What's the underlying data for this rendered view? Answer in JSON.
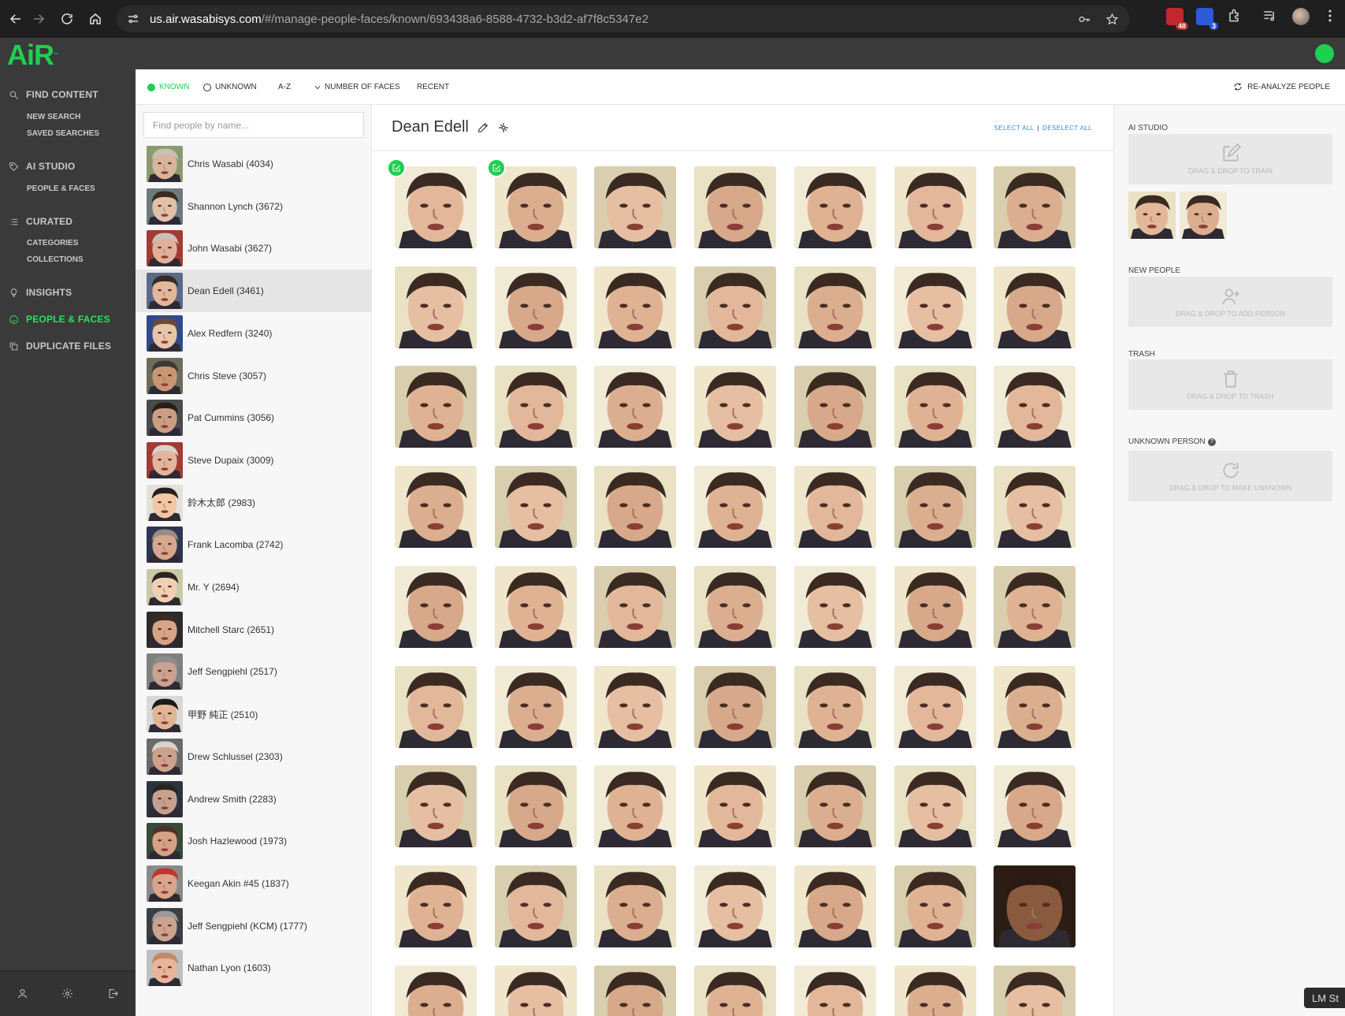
{
  "browser": {
    "url_host": "us.air.wasabisys.com",
    "url_path": "/#/manage-people-faces/known/693438a6-8588-4732-b3d2-af7f8c5347e2",
    "ext_badges": [
      "48",
      "3"
    ]
  },
  "app": {
    "logo": "AiR",
    "logo_mark": "™",
    "status_color": "#1fcf4f",
    "accent": "#1fcf4f"
  },
  "nav": {
    "find_content": "FIND CONTENT",
    "new_search": "NEW SEARCH",
    "saved_searches": "SAVED SEARCHES",
    "ai_studio": "AI STUDIO",
    "people_faces_sub": "PEOPLE & FACES",
    "curated": "CURATED",
    "categories": "CATEGORIES",
    "collections": "COLLECTIONS",
    "insights": "INSIGHTS",
    "people_faces": "PEOPLE & FACES",
    "duplicate_files": "DUPLICATE FILES"
  },
  "filters": {
    "known": "KNOWN",
    "unknown": "UNKNOWN",
    "az": "A-Z",
    "number_of_faces": "NUMBER OF FACES",
    "recent": "RECENT",
    "reanalyze": "RE-ANALYZE PEOPLE"
  },
  "people": {
    "search_placeholder": "Find people by name...",
    "selected": "Dean Edell (3461)",
    "list": [
      {
        "name": "Chris Wasabi (4034)",
        "skin": "#d9b59c",
        "hair": "#c9c0b4",
        "bg": "#8a9a6e"
      },
      {
        "name": "Shannon Lynch (3672)",
        "skin": "#e2c0a8",
        "hair": "#3b2a22",
        "bg": "#6c7a7e"
      },
      {
        "name": "John Wasabi (3627)",
        "skin": "#e0b09a",
        "hair": "#c8c0bb",
        "bg": "#a33b32"
      },
      {
        "name": "Dean Edell (3461)",
        "skin": "#e2b79a",
        "hair": "#3a2a22",
        "bg": "#5b6a8a"
      },
      {
        "name": "Alex Redfern (3240)",
        "skin": "#e8c4a8",
        "hair": "#6a4a36",
        "bg": "#2f4a8a"
      },
      {
        "name": "Chris Steve (3057)",
        "skin": "#c99674",
        "hair": "#3a3a3a",
        "bg": "#6c6c58"
      },
      {
        "name": "Pat Cummins (3056)",
        "skin": "#c99e82",
        "hair": "#2a1e1a",
        "bg": "#4a4a4a"
      },
      {
        "name": "Steve Dupaix (3009)",
        "skin": "#e6b49e",
        "hair": "#d8d2cc",
        "bg": "#a23a36"
      },
      {
        "name": "鈴木太郎 (2983)",
        "skin": "#f1c7a6",
        "hair": "#2a2020",
        "bg": "#e6e1d8"
      },
      {
        "name": "Frank Lacomba (2742)",
        "skin": "#d6a68e",
        "hair": "#9a8c84",
        "bg": "#2d3550"
      },
      {
        "name": "Mr. Y (2694)",
        "skin": "#efd0b4",
        "hair": "#2b2420",
        "bg": "#c9c9a6"
      },
      {
        "name": "Mitchell Starc (2651)",
        "skin": "#d7a486",
        "hair": "#3a2a22",
        "bg": "#2a2a2a"
      },
      {
        "name": "Jeff Sengpiehl (2517)",
        "skin": "#c9a290",
        "hair": "#8d8d8d",
        "bg": "#808080"
      },
      {
        "name": "甲野 純正 (2510)",
        "skin": "#e0b494",
        "hair": "#1e1a18",
        "bg": "#d8d8d8"
      },
      {
        "name": "Drew Schlussel (2303)",
        "skin": "#cca28c",
        "hair": "#d9d3cc",
        "bg": "#6a6a6a"
      },
      {
        "name": "Andrew Smith (2283)",
        "skin": "#c8a090",
        "hair": "#2a2420",
        "bg": "#2c3340"
      },
      {
        "name": "Josh Hazlewood (1973)",
        "skin": "#d6a084",
        "hair": "#4a3428",
        "bg": "#3a4a3a"
      },
      {
        "name": "Keegan Akin #45 (1837)",
        "skin": "#d9a48a",
        "hair": "#c0342a",
        "bg": "#8a8a8a"
      },
      {
        "name": "Jeff Sengpiehl (KCM) (1777)",
        "skin": "#c9a290",
        "hair": "#9a9a9a",
        "bg": "#3a3f44"
      },
      {
        "name": "Nathan Lyon (1603)",
        "skin": "#e8b49a",
        "hair": "#c08a6a",
        "bg": "#bfbfbf"
      }
    ]
  },
  "main": {
    "person_title": "Dean Edell",
    "select_all": "SELECT ALL",
    "deselect_all": "DESELECT ALL",
    "grid_columns": 7,
    "grid_rows": 9,
    "checked_tiles": [
      0,
      1
    ],
    "dark_tile": 55
  },
  "side": {
    "ai_studio": "AI STUDIO",
    "train_drop": "DRAG & DROP TO TRAIN",
    "new_people": "NEW PEOPLE",
    "add_drop": "DRAG & DROP TO ADD PERSON",
    "trash": "TRASH",
    "trash_drop": "DRAG & DROP TO TRASH",
    "unknown_person": "UNKNOWN PERSON",
    "unknown_drop": "DRAG & DROP TO MAKE UNKNOWN",
    "help": "?"
  },
  "corner_tag": "LM St"
}
